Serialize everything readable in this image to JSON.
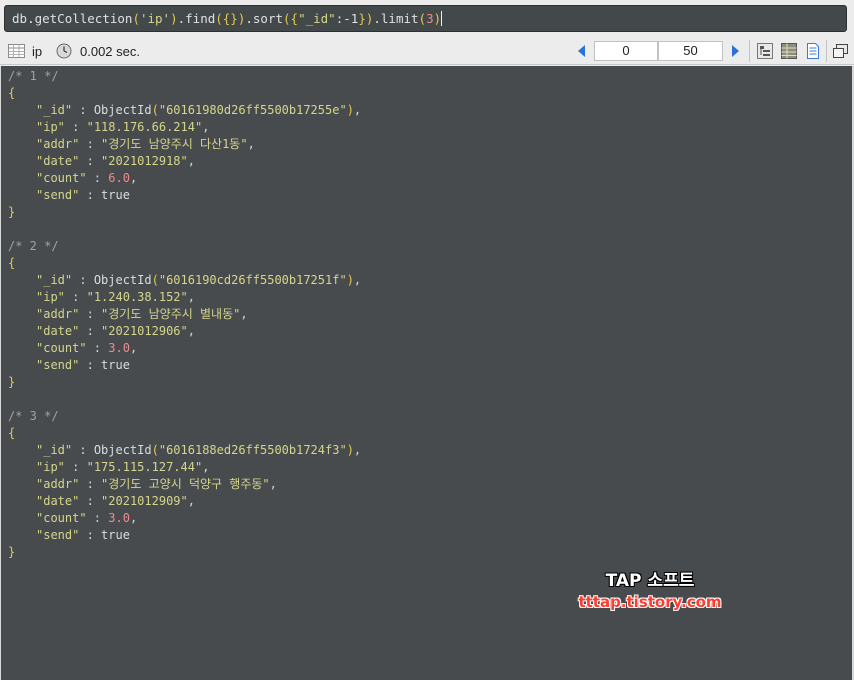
{
  "query": {
    "prefix": "db",
    "m1": "getCollection",
    "arg1": "'ip'",
    "m2": "find",
    "arg2": "{}",
    "m3": "sort",
    "arg3_open": "{",
    "arg3_key": "\"_id\"",
    "arg3_colon": ":",
    "arg3_val": "-1",
    "arg3_close": "}",
    "m4": "limit",
    "arg4": "3"
  },
  "toolbar": {
    "collection_name": "ip",
    "elapsed": "0.002 sec.",
    "skip": "0",
    "limit": "50"
  },
  "documents": [
    {
      "comment": "/* 1 */",
      "_id": "\"60161980d26ff5500b17255e\"",
      "ip": "\"118.176.66.214\"",
      "addr": "\"경기도 남양주시 다산1동\"",
      "date": "\"2021012918\"",
      "count": "6.0",
      "send": "true"
    },
    {
      "comment": "/* 2 */",
      "_id": "\"6016190cd26ff5500b17251f\"",
      "ip": "\"1.240.38.152\"",
      "addr": "\"경기도 남양주시 별내동\"",
      "date": "\"2021012906\"",
      "count": "3.0",
      "send": "true"
    },
    {
      "comment": "/* 3 */",
      "_id": "\"6016188ed26ff5500b1724f3\"",
      "ip": "\"175.115.127.44\"",
      "addr": "\"경기도 고양시 덕양구 행주동\"",
      "date": "\"2021012909\"",
      "count": "3.0",
      "send": "true"
    }
  ],
  "labels": {
    "open_brace": "{",
    "close_brace": "}",
    "k_id": "\"_id\"",
    "k_ip": "\"ip\"",
    "k_addr": "\"addr\"",
    "k_date": "\"date\"",
    "k_count": "\"count\"",
    "k_send": "\"send\"",
    "sep": " : ",
    "objectid_fn": "ObjectId",
    "comma": ","
  },
  "watermark": {
    "title": "TAP 소프트",
    "url": "tttap.tistory.com"
  },
  "icons": {
    "table": "table-view-icon",
    "clock": "clock-icon",
    "prev": "prev-page-icon",
    "next": "next-page-icon",
    "tree": "tree-view-icon",
    "tableview": "table-mode-icon",
    "text": "text-mode-icon",
    "window": "new-window-icon"
  },
  "colors": {
    "results_bg": "#474b4e",
    "key": "#d6d68a",
    "number": "#f08a8a",
    "brace": "#e4c94a",
    "accent": "#2a73d6"
  }
}
